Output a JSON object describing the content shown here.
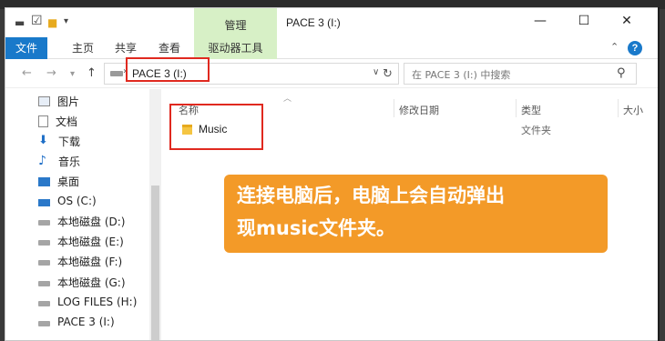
{
  "window": {
    "title": "PACE 3 (I:)",
    "manage_tab": "管理",
    "controls": {
      "minimize": "—",
      "maximize": "☐",
      "close": "✕"
    }
  },
  "ribbon": {
    "file_tab": "文件",
    "tabs": [
      "主页",
      "共享",
      "查看"
    ],
    "drive_tools": "驱动器工具",
    "help": "?"
  },
  "address": {
    "path": "PACE 3 (I:)",
    "search_placeholder": "在 PACE 3 (I:) 中搜索"
  },
  "sidebar": {
    "items": [
      {
        "label": "图片",
        "icon": "pictures-icon"
      },
      {
        "label": "文档",
        "icon": "documents-icon"
      },
      {
        "label": "下载",
        "icon": "downloads-icon"
      },
      {
        "label": "音乐",
        "icon": "music-icon"
      },
      {
        "label": "桌面",
        "icon": "desktop-icon"
      },
      {
        "label": "OS (C:)",
        "icon": "windows-drive-icon"
      },
      {
        "label": "本地磁盘 (D:)",
        "icon": "drive-icon"
      },
      {
        "label": "本地磁盘 (E:)",
        "icon": "drive-icon"
      },
      {
        "label": "本地磁盘 (F:)",
        "icon": "drive-icon"
      },
      {
        "label": "本地磁盘 (G:)",
        "icon": "drive-icon"
      },
      {
        "label": "LOG FILES (H:)",
        "icon": "drive-icon"
      },
      {
        "label": "PACE 3 (I:)",
        "icon": "drive-icon"
      }
    ]
  },
  "columns": {
    "name": "名称",
    "modified": "修改日期",
    "type": "类型",
    "size": "大小"
  },
  "files": [
    {
      "name": "Music",
      "type": "文件夹"
    }
  ],
  "callout": {
    "line1": "连接电脑后，电脑上会自动弹出",
    "line2": "现music文件夹。"
  },
  "colors": {
    "accent": "#1979ca",
    "manage_bg": "#d7f0c6",
    "highlight": "#e0291f",
    "callout_bg": "#f39a28"
  }
}
